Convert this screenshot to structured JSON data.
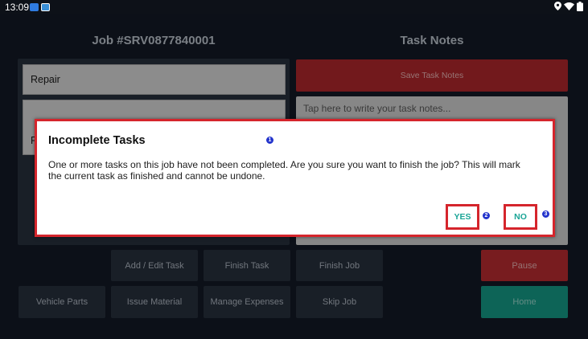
{
  "status_bar": {
    "time": "13:09",
    "left_icons": [
      "notification-app-icon",
      "screenshot-icon"
    ],
    "right_icons": [
      "location-icon",
      "wifi-icon",
      "battery-icon"
    ]
  },
  "left": {
    "title": "Job #SRV0877840001",
    "fields": [
      "Repair",
      "R"
    ]
  },
  "right": {
    "title": "Task Notes",
    "save_label": "Save Task Notes",
    "notes_placeholder": "Tap here to write your task notes..."
  },
  "buttons": {
    "add_edit_task": "Add / Edit Task",
    "finish_task": "Finish Task",
    "finish_job": "Finish Job",
    "pause": "Pause",
    "vehicle_parts": "Vehicle Parts",
    "issue_material": "Issue Material",
    "manage_expenses": "Manage Expenses",
    "skip_job": "Skip Job",
    "home": "Home"
  },
  "dialog": {
    "title": "Incomplete Tasks",
    "message": "One or more tasks on this job have not been completed. Are you sure you want to finish the job? This will mark the current task as finished and cannot be undone.",
    "yes_label": "YES",
    "no_label": "NO"
  },
  "markers": [
    "1",
    "2",
    "3"
  ],
  "colors": {
    "background": "#131a26",
    "panel": "#27303d",
    "danger": "#b82c30",
    "teal": "#159a86",
    "highlight": "#d5252c",
    "marker": "#2233cc"
  }
}
